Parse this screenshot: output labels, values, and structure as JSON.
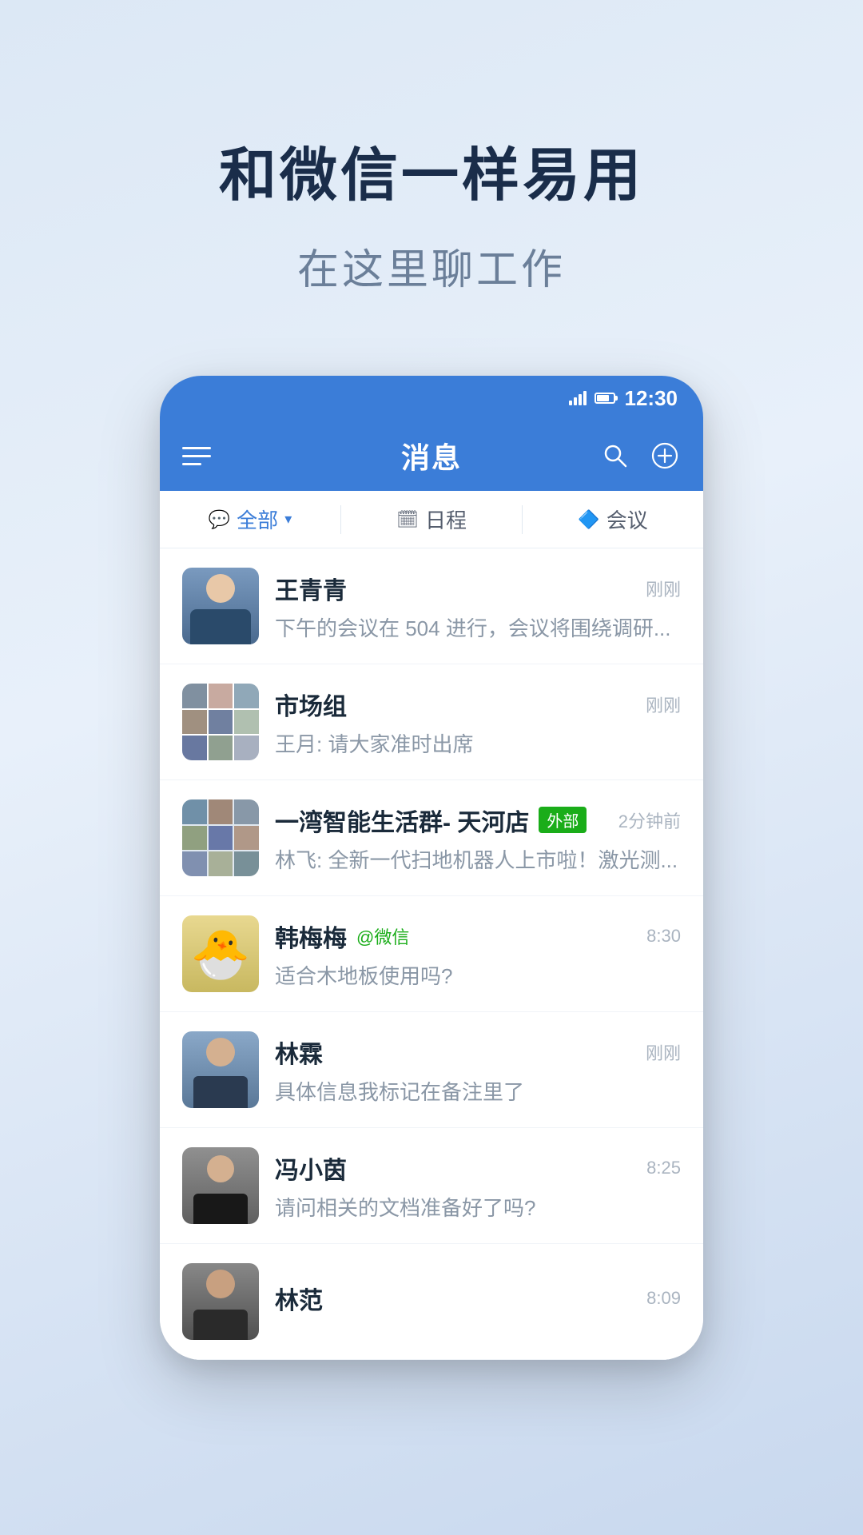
{
  "hero": {
    "title": "和微信一样易用",
    "subtitle": "在这里聊工作"
  },
  "statusBar": {
    "time": "12:30"
  },
  "header": {
    "title": "消息",
    "menuLabel": "菜单",
    "searchLabel": "搜索",
    "addLabel": "添加"
  },
  "tabs": [
    {
      "id": "all",
      "icon": "💬",
      "label": "全部",
      "active": true,
      "hasChevron": true
    },
    {
      "id": "schedule",
      "icon": "📅",
      "label": "日程",
      "active": false
    },
    {
      "id": "meeting",
      "icon": "🔷",
      "label": "会议",
      "active": false
    }
  ],
  "chats": [
    {
      "id": "wqq",
      "name": "王青青",
      "preview": "下午的会议在 504 进行，会议将围绕调研...",
      "time": "刚刚",
      "badge": "",
      "avatarType": "person-female-blue"
    },
    {
      "id": "market",
      "name": "市场组",
      "preview": "王月: 请大家准时出席",
      "time": "刚刚",
      "badge": "",
      "avatarType": "group"
    },
    {
      "id": "yiwan",
      "name": "一湾智能生活群- 天河店",
      "preview": "林飞: 全新一代扫地机器人上市啦！激光测...",
      "time": "2分钟前",
      "badge": "外部",
      "avatarType": "group2"
    },
    {
      "id": "han",
      "name": "韩梅梅",
      "nameExtra": "@微信",
      "preview": "适合木地板使用吗?",
      "time": "8:30",
      "badge": "",
      "avatarType": "chick"
    },
    {
      "id": "lin霖",
      "name": "林霖",
      "preview": "具体信息我标记在备注里了",
      "time": "刚刚",
      "badge": "",
      "avatarType": "person-female-dark"
    },
    {
      "id": "feng",
      "name": "冯小茵",
      "preview": "请问相关的文档准备好了吗?",
      "time": "8:25",
      "badge": "",
      "avatarType": "person-female-gray"
    },
    {
      "id": "linfan",
      "name": "林范",
      "preview": "",
      "time": "8:09",
      "badge": "",
      "avatarType": "person-male"
    }
  ],
  "colors": {
    "primary": "#3b7dd8",
    "green": "#1aad19",
    "textDark": "#1a2a3a",
    "textGray": "#8a97a6",
    "timeGray": "#aab4c0"
  }
}
